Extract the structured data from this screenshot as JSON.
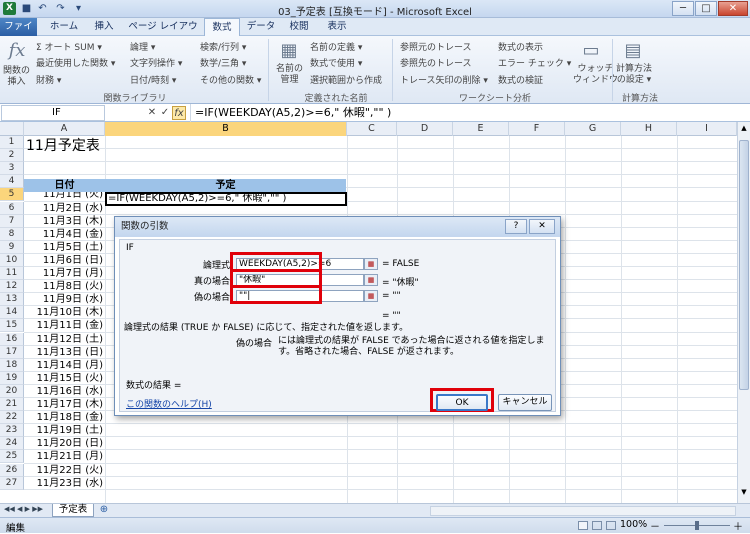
{
  "window": {
    "title": "03_予定表 [互換モード] - Microsoft Excel",
    "minimize": "─",
    "maximize": "□",
    "close": "✕"
  },
  "qat": {
    "app_icon": "X",
    "save": "■",
    "undo": "↶",
    "redo": "↷",
    "more": "▾"
  },
  "tabs": [
    {
      "label": "ファイル"
    },
    {
      "label": "ホーム"
    },
    {
      "label": "挿入"
    },
    {
      "label": "ページ レイアウト"
    },
    {
      "label": "数式"
    },
    {
      "label": "データ"
    },
    {
      "label": "校閲"
    },
    {
      "label": "表示"
    }
  ],
  "ribbon": {
    "insert_function": "関数の\n挿入",
    "autosum": "Σ オート SUM ▾",
    "recent": "最近使用した関数 ▾",
    "financial": "財務 ▾",
    "logical": "論理 ▾",
    "text": "文字列操作 ▾",
    "datetime": "日付/時刻 ▾",
    "lookup": "検索/行列 ▾",
    "math": "数学/三角 ▾",
    "more_functions": "その他の関数 ▾",
    "group_library": "関数ライブラリ",
    "name_manager": "名前の\n管理",
    "define_name": "名前の定義 ▾",
    "use_in_formula": "数式で使用 ▾",
    "create_from_selection": "選択範囲から作成",
    "group_names": "定義された名前",
    "trace_precedents": "参照元のトレース",
    "trace_dependents": "参照先のトレース",
    "remove_arrows": "トレース矢印の削除 ▾",
    "show_formulas": "数式の表示",
    "error_checking": "エラー チェック ▾",
    "evaluate_formula": "数式の検証",
    "watch_window": "ウォッチ\nウィンドウ",
    "group_auditing": "ワークシート分析",
    "calc_options": "計算方法\nの設定 ▾",
    "group_calc": "計算方法"
  },
  "formula_bar": {
    "name_box": "IF",
    "cancel": "✕",
    "enter": "✓",
    "fx": "fx",
    "formula": "=IF(WEEKDAY(A5,2)>=6,\" 休暇\",\"\" )"
  },
  "columns": [
    "A",
    "B",
    "C",
    "D",
    "E",
    "F",
    "G",
    "H",
    "I"
  ],
  "rows": [
    "1",
    "2",
    "3",
    "4",
    "5",
    "6",
    "7",
    "8",
    "9",
    "10",
    "11",
    "12",
    "13",
    "14",
    "15",
    "16",
    "17",
    "18",
    "19",
    "20",
    "21",
    "22",
    "23",
    "24",
    "25",
    "26",
    "27"
  ],
  "sheet": {
    "title": "11月予定表",
    "header_date": "日付",
    "header_plan": "予定",
    "active_cell_text": "=IF(WEEKDAY(A5,2)>=6,\" 休暇\",\"\" )",
    "dates": [
      "11月1日 (火)",
      "11月2日 (水)",
      "11月3日 (木)",
      "11月4日 (金)",
      "11月5日 (土)",
      "11月6日 (日)",
      "11月7日 (月)",
      "11月8日 (火)",
      "11月9日 (水)",
      "11月10日 (木)",
      "11月11日 (金)",
      "11月12日 (土)",
      "11月13日 (日)",
      "11月14日 (月)",
      "11月15日 (火)",
      "11月16日 (水)",
      "11月17日 (木)",
      "11月18日 (金)",
      "11月19日 (土)",
      "11月20日 (日)",
      "11月21日 (月)",
      "11月22日 (火)",
      "11月23日 (水)"
    ]
  },
  "dialog": {
    "title": "関数の引数",
    "help": "?",
    "close": "✕",
    "function_name": "IF",
    "args": [
      {
        "label": "論理式",
        "value": "WEEKDAY(A5,2)>=6",
        "result": "=  FALSE"
      },
      {
        "label": "真の場合",
        "value": "\"休暇\"",
        "result": "=  \"休暇\""
      },
      {
        "label": "偽の場合",
        "value": "\"\"|",
        "result": "=  \"\""
      }
    ],
    "overall_result": "=  \"\"",
    "description": "論理式の結果 (TRUE か FALSE) に応じて、指定された値を返します。",
    "arg_name": "偽の場合",
    "arg_description": "には論理式の結果が FALSE であった場合に返される値を指定します。省略された場合、FALSE が返されます。",
    "formula_result": "数式の結果 =",
    "help_link": "この関数のヘルプ(H)",
    "ok": "OK",
    "cancel": "キャンセル"
  },
  "sheet_tabs": {
    "nav": "◀◀ ◀ ▶ ▶▶",
    "active": "予定表",
    "new": "⊕"
  },
  "status": {
    "mode": "編集",
    "zoom": "100%",
    "minus": "－",
    "plus": "＋"
  },
  "colors": {
    "accent": "#2b5ea4",
    "highlight": "#e0000a",
    "selected_header": "#fbd57c",
    "table_header": "#9dc2e8"
  }
}
